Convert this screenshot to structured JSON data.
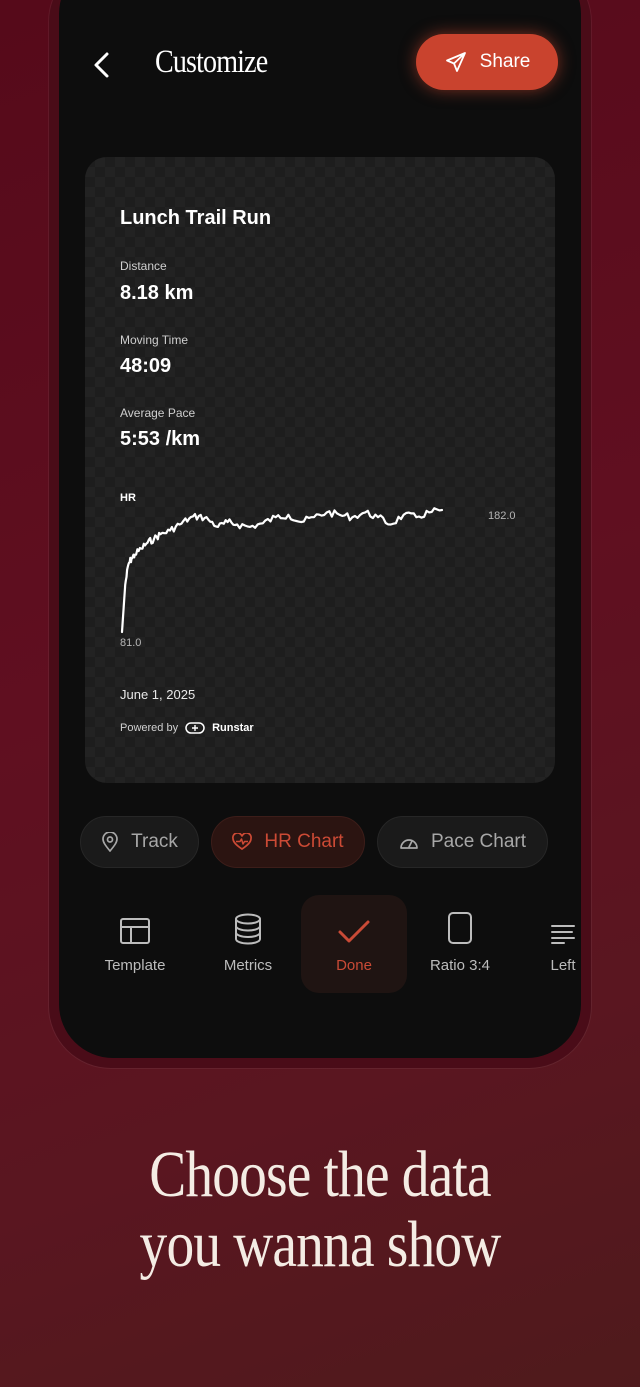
{
  "header": {
    "title": "Customize",
    "share_label": "Share"
  },
  "card": {
    "title": "Lunch Trail Run",
    "metrics": [
      {
        "label": "Distance",
        "value": "8.18 km"
      },
      {
        "label": "Moving Time",
        "value": "48:09"
      },
      {
        "label": "Average Pace",
        "value": "5:53 /km"
      }
    ],
    "hr": {
      "label": "HR",
      "min_label": "81.0",
      "max_label": "182.0"
    },
    "date": "June 1, 2025",
    "powered_by": "Powered by",
    "brand": "Runstar"
  },
  "chart_data": {
    "type": "line",
    "title": "",
    "xlabel": "",
    "ylabel": "HR",
    "ylim": [
      81,
      182
    ],
    "grid": false,
    "series": [
      {
        "name": "",
        "x": [
          0,
          1,
          2,
          3,
          4,
          6,
          8,
          10,
          12,
          15,
          18,
          21,
          24,
          27,
          30,
          33,
          36,
          40,
          44,
          48,
          52,
          56,
          60,
          64,
          68,
          72,
          76,
          80,
          84,
          88,
          92,
          96,
          100
        ],
        "y": [
          81,
          120,
          137,
          142,
          145,
          150,
          155,
          158,
          162,
          165,
          170,
          175,
          177,
          174,
          168,
          172,
          170,
          168,
          171,
          176,
          178,
          172,
          176,
          180,
          178,
          176,
          180,
          176,
          170,
          178,
          176,
          180,
          182
        ]
      }
    ]
  },
  "chips": [
    {
      "label": "Track",
      "icon": "location-pin-icon",
      "active": false
    },
    {
      "label": "HR Chart",
      "icon": "heart-rate-icon",
      "active": true
    },
    {
      "label": "Pace Chart",
      "icon": "speedometer-icon",
      "active": false
    }
  ],
  "toolbar": [
    {
      "label": "Template",
      "icon": "layout-icon"
    },
    {
      "label": "Metrics",
      "icon": "database-icon"
    },
    {
      "label": "Done",
      "icon": "checkmark-icon",
      "active": true
    },
    {
      "label": "Ratio 3:4",
      "icon": "ratio-icon"
    },
    {
      "label": "Left",
      "icon": "align-left-icon"
    }
  ],
  "tagline": {
    "line1": "Choose the data",
    "line2": "you wanna show"
  },
  "colors": {
    "accent": "#c9432e",
    "background": "#5a0f1e",
    "card": "#1d1d1d"
  }
}
